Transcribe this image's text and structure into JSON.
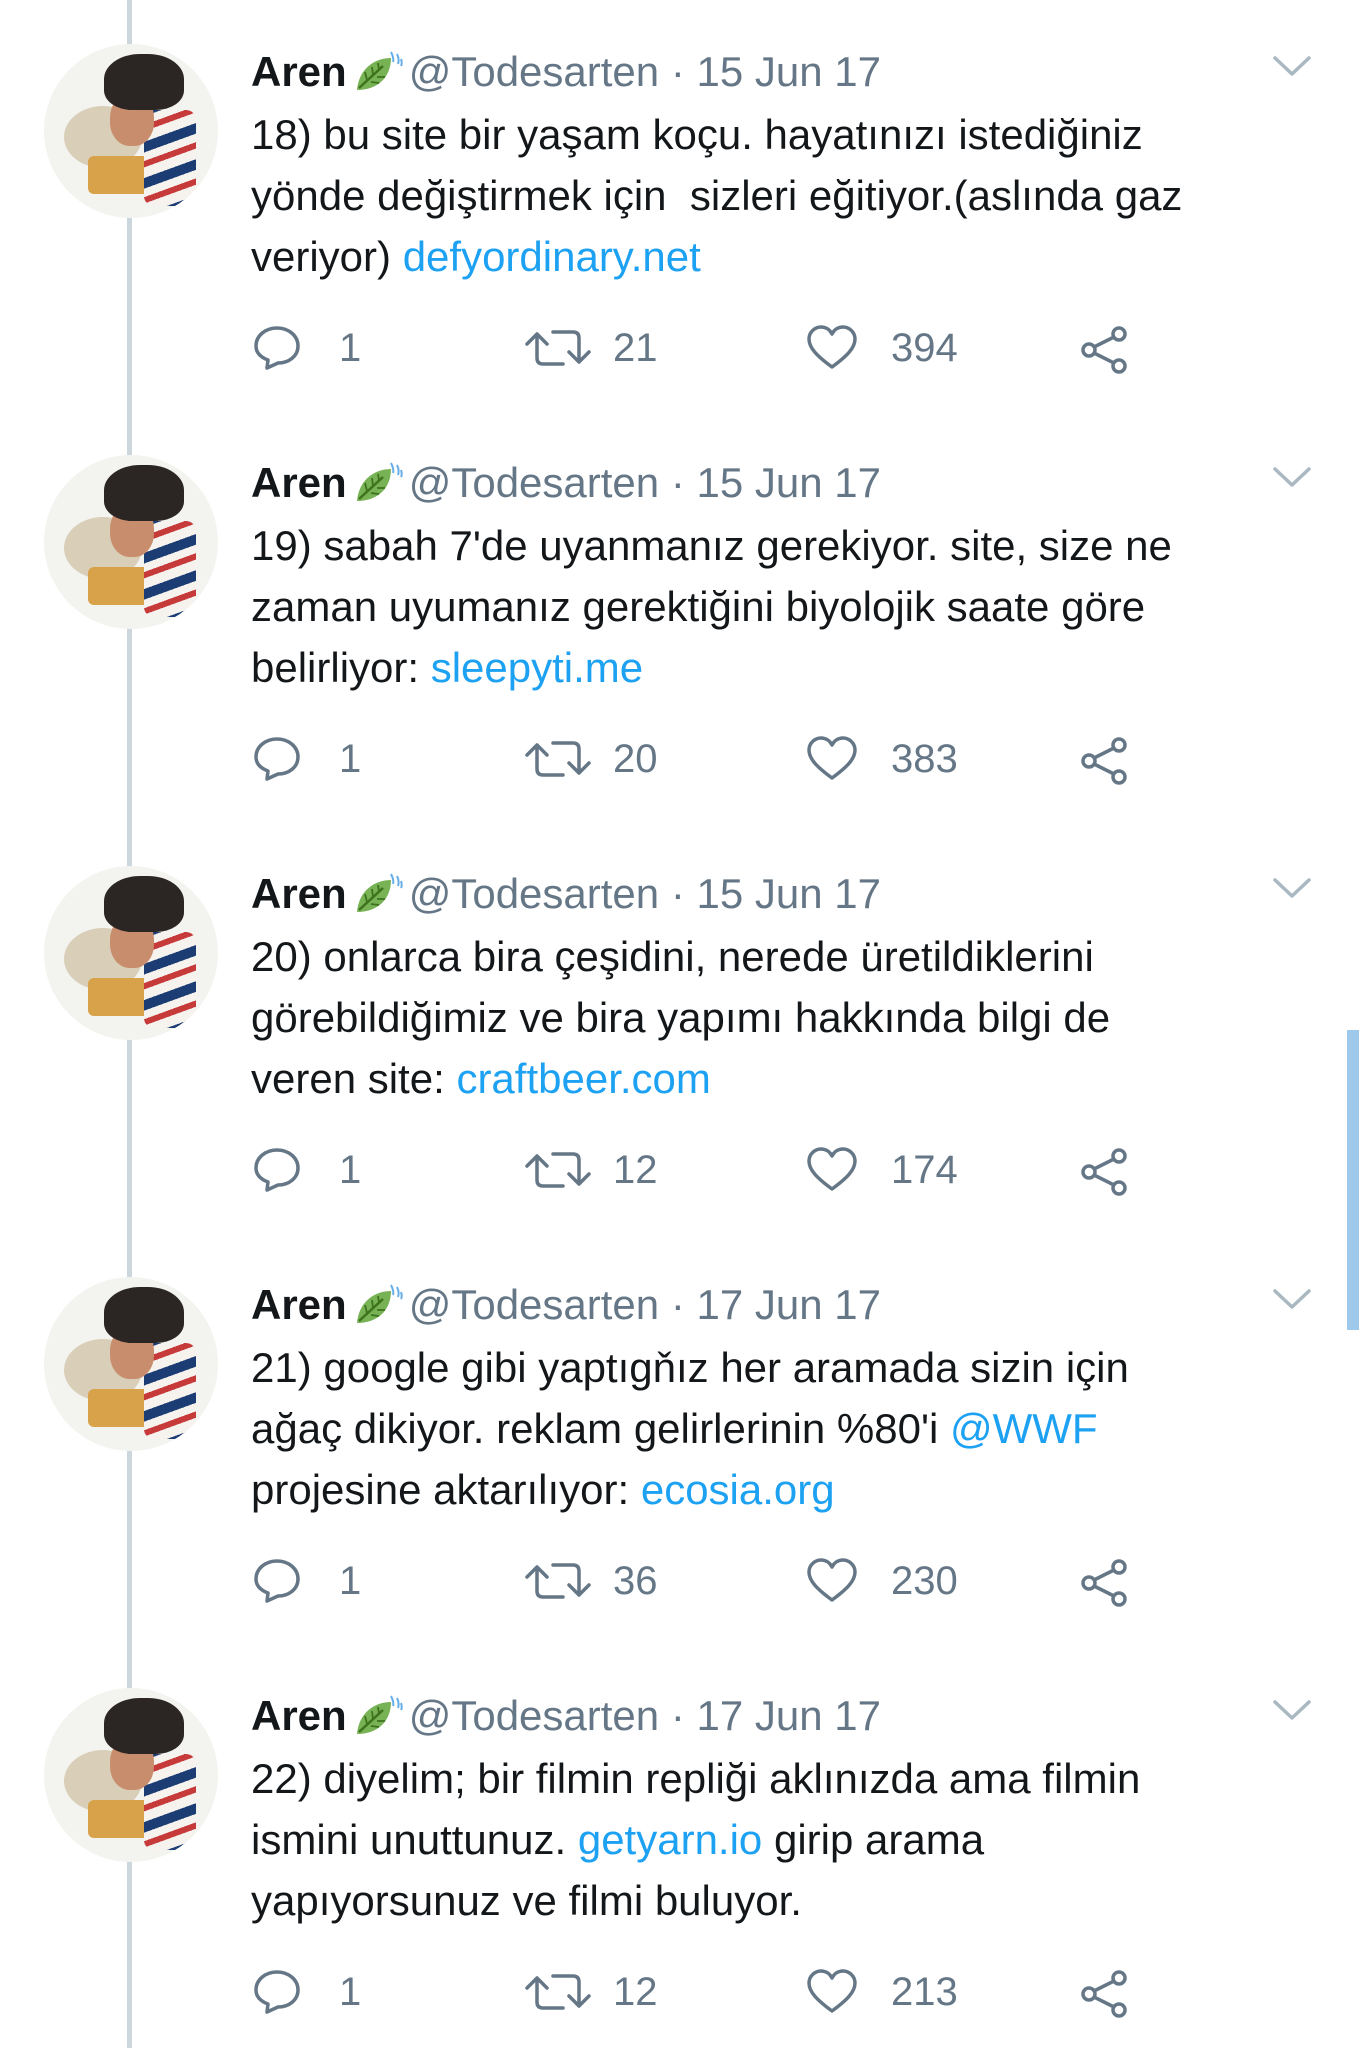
{
  "author": {
    "name": "Aren",
    "handle": "@Todesarten",
    "separator": "·"
  },
  "icons": {
    "leaf": "leaf-emoji-icon",
    "menu": "chevron-down-icon",
    "reply": "reply-icon",
    "retweet": "retweet-icon",
    "like": "heart-icon",
    "share": "share-icon"
  },
  "colors": {
    "link": "#1da1f2",
    "muted": "#657786",
    "text": "#14171a",
    "thread_line": "#ccd6dd"
  },
  "tweets": [
    {
      "date": "15 Jun 17",
      "lines": [
        [
          {
            "t": "18) bu site bir yaşam koçu. hayatınızı istediğiniz"
          }
        ],
        [
          {
            "t": "yönde değiştirmek için  sizleri eğitiyor.(aslında gaz"
          }
        ],
        [
          {
            "t": "veriyor) "
          },
          {
            "t": "defyordinary.net",
            "link": true
          }
        ]
      ],
      "replies": "1",
      "retweets": "21",
      "likes": "394"
    },
    {
      "date": "15 Jun 17",
      "lines": [
        [
          {
            "t": "19) sabah 7'de uyanmanız gerekiyor. site, size ne"
          }
        ],
        [
          {
            "t": "zaman uyumanız gerektiğini biyolojik saate göre"
          }
        ],
        [
          {
            "t": "belirliyor: "
          },
          {
            "t": "sleepyti.me",
            "link": true
          }
        ]
      ],
      "replies": "1",
      "retweets": "20",
      "likes": "383"
    },
    {
      "date": "15 Jun 17",
      "lines": [
        [
          {
            "t": "20) onlarca bira çeşidini, nerede üretildiklerini"
          }
        ],
        [
          {
            "t": "görebildiğimiz ve bira yapımı hakkında bilgi de"
          }
        ],
        [
          {
            "t": "veren site: "
          },
          {
            "t": "craftbeer.com",
            "link": true
          }
        ]
      ],
      "replies": "1",
      "retweets": "12",
      "likes": "174"
    },
    {
      "date": "17 Jun 17",
      "lines": [
        [
          {
            "t": "21) google gibi yaptıgňız her aramada sizin için"
          }
        ],
        [
          {
            "t": "ağaç dikiyor. reklam gelirlerinin %80'i "
          },
          {
            "t": "@WWF",
            "link": true
          }
        ],
        [
          {
            "t": "projesine aktarılıyor: "
          },
          {
            "t": "ecosia.org",
            "link": true
          }
        ]
      ],
      "replies": "1",
      "retweets": "36",
      "likes": "230"
    },
    {
      "date": "17 Jun 17",
      "lines": [
        [
          {
            "t": "22) diyelim; bir filmin repliği aklınızda ama filmin"
          }
        ],
        [
          {
            "t": "ismini unuttunuz. "
          },
          {
            "t": "getyarn.io",
            "link": true
          },
          {
            "t": " girip arama"
          }
        ],
        [
          {
            "t": "yapıyorsunuz ve filmi buluyor."
          }
        ]
      ],
      "replies": "1",
      "retweets": "12",
      "likes": "213"
    }
  ]
}
